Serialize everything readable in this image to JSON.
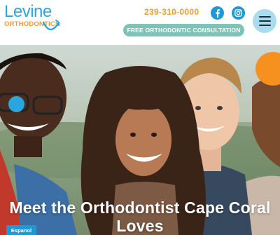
{
  "header": {
    "logo": {
      "name": "Levine",
      "subtitle": "ORTHODONTICS"
    },
    "phone": "239-310-0000",
    "cta_label": "FREE ORTHODONTIC CONSULTATION",
    "social": [
      {
        "icon": "facebook-icon",
        "glyph": "f"
      },
      {
        "icon": "instagram-icon",
        "glyph": ""
      }
    ],
    "menu_icon": "hamburger-menu-icon"
  },
  "hero": {
    "headline": "Meet the Orthodontist Cape Coral Loves",
    "language_button": "Espanol",
    "image": "four-smiling-teens-photo"
  },
  "colors": {
    "brand_blue": "#2aa7df",
    "brand_orange": "#f39a2d",
    "cta_teal": "#7cc3b8",
    "menu_bg": "#a9dcef",
    "social_blue": "#1a9bd7",
    "deco_orange": "#f6901f",
    "espanol_blue": "#1d9ad6"
  }
}
